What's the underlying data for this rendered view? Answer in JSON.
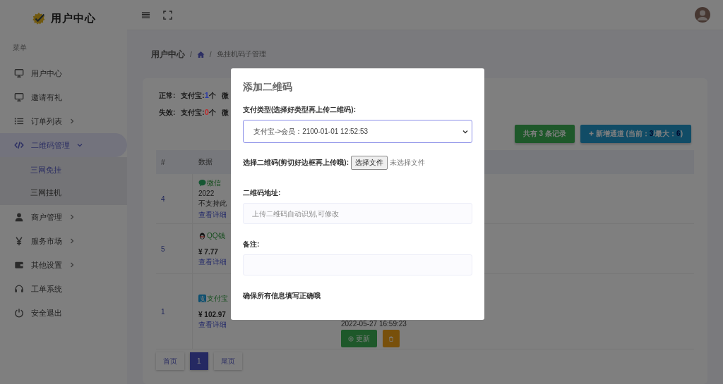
{
  "sidebar": {
    "brand": "用户中心",
    "section_label": "菜单",
    "items": [
      {
        "label": "用户中心",
        "kind": "monitor",
        "selected": false
      },
      {
        "label": "邀请有礼",
        "kind": "monitor",
        "selected": false
      },
      {
        "label": "订单列表",
        "kind": "list",
        "selected": false,
        "expanded": false
      },
      {
        "label": "二维码管理",
        "kind": "code",
        "selected": true,
        "expanded": true,
        "children": [
          {
            "label": "三网免挂",
            "selected": true
          },
          {
            "label": "三网挂机",
            "selected": false
          }
        ]
      },
      {
        "label": "商户管理",
        "kind": "user",
        "selected": false,
        "expanded": false
      },
      {
        "label": "服务市场",
        "kind": "yen",
        "selected": false,
        "expanded": false
      },
      {
        "label": "其他设置",
        "kind": "wallet",
        "selected": false,
        "expanded": false
      },
      {
        "label": "工单系统",
        "kind": "headset",
        "selected": false
      },
      {
        "label": "安全退出",
        "kind": "power",
        "selected": false
      }
    ]
  },
  "breadcrumb": {
    "title": "用户中心",
    "items": [
      {
        "kind": "separator",
        "text": "/"
      },
      {
        "kind": "home"
      },
      {
        "kind": "separator",
        "text": "/"
      },
      {
        "kind": "text",
        "text": "免挂机码子管理"
      }
    ]
  },
  "stats": [
    {
      "label": "正常:",
      "name": "支付宝:",
      "count": "1",
      "unit": "个",
      "color": "#2b3aa6",
      "next": "微"
    },
    {
      "label": "失效:",
      "name": "支付宝:",
      "count": "0",
      "unit": "个",
      "color": "#c0282a",
      "next": "微"
    }
  ],
  "record_count": "共有 3 条记录",
  "add_channel": {
    "prefix": "新增通道 (当前：",
    "current": "3",
    "mid": "/最大：",
    "max": "6",
    "suffix": ")"
  },
  "table": {
    "columns": [
      "#",
      "数据"
    ],
    "rows": [
      {
        "id": "4",
        "kind": "wechat",
        "channel": "微信",
        "lines": [
          "2022",
          "不支持此"
        ],
        "link": "查看详细"
      },
      {
        "id": "5",
        "kind": "qq",
        "channel": "QQ钱",
        "amount": "¥ 7.77",
        "link": "查看详细"
      },
      {
        "id": "1",
        "kind": "alipay",
        "channel": "支付宝",
        "amount": "¥ 102.97",
        "link": "查看详细",
        "time": "2022-05-27 16:59:23",
        "update": "更新"
      }
    ]
  },
  "pagination": [
    {
      "label": "首页",
      "selected": false
    },
    {
      "label": "1",
      "selected": true
    },
    {
      "label": "尾页",
      "selected": false
    }
  ],
  "modal": {
    "title": "添加二维码",
    "fields": [
      {
        "kind": "select",
        "label": "支付类型(选择好类型再上传二维码):",
        "value": "支付宝->会员：2100-01-01 12:52:53"
      },
      {
        "kind": "file",
        "label": "选择二维码(剪切好边框再上传哦):",
        "button": "选择文件",
        "status": "未选择文件"
      },
      {
        "kind": "text",
        "label": "二维码地址:",
        "placeholder": "上传二维码自动识别,可修改"
      },
      {
        "kind": "text",
        "label": "备注:"
      }
    ],
    "note": "确保所有信息填写正确哦"
  }
}
